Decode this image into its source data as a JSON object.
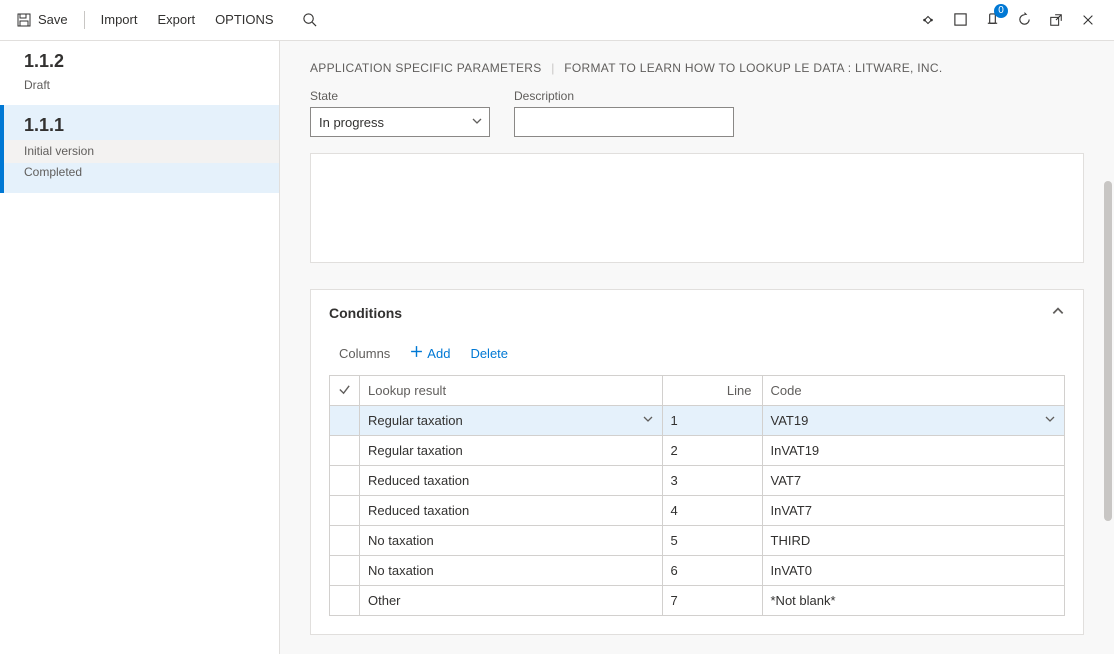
{
  "toolbar": {
    "save": "Save",
    "import": "Import",
    "export": "Export",
    "options": "OPTIONS"
  },
  "sys": {
    "notif_count": "0"
  },
  "sidebar": {
    "items": [
      {
        "title": "1.1.2",
        "sub": "Draft"
      },
      {
        "title": "1.1.1",
        "sub1": "Initial version",
        "sub2": "Completed"
      }
    ]
  },
  "breadcrumb": {
    "a": "APPLICATION SPECIFIC PARAMETERS",
    "b": "FORMAT TO LEARN HOW TO LOOKUP LE DATA : LITWARE, INC."
  },
  "fields": {
    "state_label": "State",
    "state_value": "In progress",
    "desc_label": "Description",
    "desc_value": ""
  },
  "conditions": {
    "title": "Conditions",
    "toolbar": {
      "columns": "Columns",
      "add": "Add",
      "delete": "Delete"
    },
    "headers": {
      "lookup": "Lookup result",
      "line": "Line",
      "code": "Code"
    },
    "rows": [
      {
        "lookup": "Regular taxation",
        "line": "1",
        "code": "VAT19"
      },
      {
        "lookup": "Regular taxation",
        "line": "2",
        "code": "InVAT19"
      },
      {
        "lookup": "Reduced taxation",
        "line": "3",
        "code": "VAT7"
      },
      {
        "lookup": "Reduced taxation",
        "line": "4",
        "code": "InVAT7"
      },
      {
        "lookup": "No taxation",
        "line": "5",
        "code": "THIRD"
      },
      {
        "lookup": "No taxation",
        "line": "6",
        "code": "InVAT0"
      },
      {
        "lookup": "Other",
        "line": "7",
        "code": "*Not blank*"
      }
    ]
  }
}
